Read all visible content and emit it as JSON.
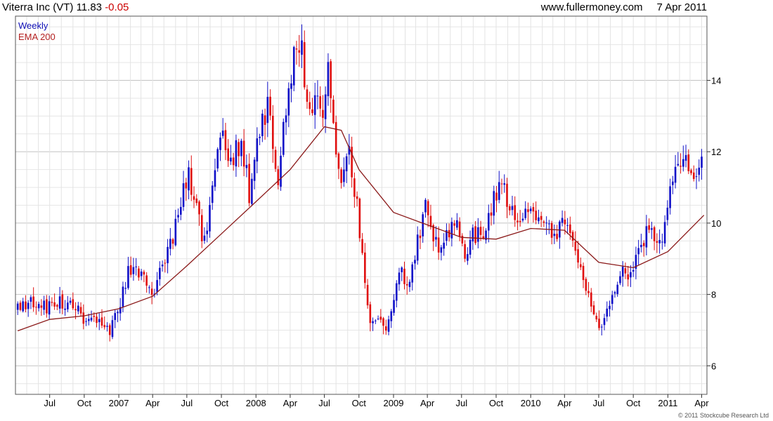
{
  "header": {
    "symbol": "Viterra Inc (VT) 11.83",
    "change": "-0.05",
    "site": "www.fullermoney.com",
    "date": "7 Apr 2011"
  },
  "legend": {
    "weekly": "Weekly",
    "ema": "EMA 200"
  },
  "copyright": "© 2011 Stockcube Research Ltd",
  "colors": {
    "up": "#1010c8",
    "down": "#e01010",
    "ema": "#8b1a1a",
    "grid": "#d8d8d8"
  },
  "chart_data": {
    "type": "candlestick",
    "frequency": "weekly",
    "x_range": [
      "2006-04",
      "2011-04"
    ],
    "ylim": [
      5.2,
      15.8
    ],
    "y_ticks": [
      6,
      8,
      10,
      12,
      14
    ],
    "y_axis_side": "right",
    "x_ticks": [
      {
        "label": "Jul",
        "date": "2006-07-01"
      },
      {
        "label": "Oct",
        "date": "2006-10-01"
      },
      {
        "label": "2007",
        "date": "2007-01-01"
      },
      {
        "label": "Apr",
        "date": "2007-04-01"
      },
      {
        "label": "Jul",
        "date": "2007-07-01"
      },
      {
        "label": "Oct",
        "date": "2007-10-01"
      },
      {
        "label": "2008",
        "date": "2008-01-01"
      },
      {
        "label": "Apr",
        "date": "2008-04-01"
      },
      {
        "label": "Jul",
        "date": "2008-07-01"
      },
      {
        "label": "Oct",
        "date": "2008-10-01"
      },
      {
        "label": "2009",
        "date": "2009-01-01"
      },
      {
        "label": "Apr",
        "date": "2009-04-01"
      },
      {
        "label": "Jul",
        "date": "2009-07-01"
      },
      {
        "label": "Oct",
        "date": "2009-10-01"
      },
      {
        "label": "2010",
        "date": "2010-01-01"
      },
      {
        "label": "Apr",
        "date": "2010-04-01"
      },
      {
        "label": "Jul",
        "date": "2010-07-01"
      },
      {
        "label": "Oct",
        "date": "2010-10-01"
      },
      {
        "label": "2011",
        "date": "2011-01-01"
      },
      {
        "label": "Apr",
        "date": "2011-04-01"
      }
    ],
    "grid": true,
    "close_path": [
      {
        "date": "2006-04-07",
        "value": 7.6
      },
      {
        "date": "2006-05-15",
        "value": 7.8
      },
      {
        "date": "2006-06-15",
        "value": 7.6
      },
      {
        "date": "2006-07-15",
        "value": 7.9
      },
      {
        "date": "2006-08-15",
        "value": 7.7
      },
      {
        "date": "2006-09-15",
        "value": 7.5
      },
      {
        "date": "2006-10-10",
        "value": 7.1
      },
      {
        "date": "2006-11-10",
        "value": 7.2
      },
      {
        "date": "2006-12-05",
        "value": 7.0
      },
      {
        "date": "2006-12-31",
        "value": 7.6
      },
      {
        "date": "2007-01-25",
        "value": 8.6
      },
      {
        "date": "2007-02-20",
        "value": 8.8
      },
      {
        "date": "2007-03-10",
        "value": 8.4
      },
      {
        "date": "2007-03-31",
        "value": 8.1
      },
      {
        "date": "2007-04-20",
        "value": 8.6
      },
      {
        "date": "2007-05-15",
        "value": 9.3
      },
      {
        "date": "2007-06-10",
        "value": 10.2
      },
      {
        "date": "2007-07-05",
        "value": 11.6
      },
      {
        "date": "2007-07-25",
        "value": 10.4
      },
      {
        "date": "2007-08-15",
        "value": 9.5
      },
      {
        "date": "2007-09-10",
        "value": 11.2
      },
      {
        "date": "2007-10-05",
        "value": 12.5
      },
      {
        "date": "2007-10-31",
        "value": 11.6
      },
      {
        "date": "2007-11-20",
        "value": 12.4
      },
      {
        "date": "2007-12-15",
        "value": 10.8
      },
      {
        "date": "2008-01-10",
        "value": 12.6
      },
      {
        "date": "2008-02-05",
        "value": 13.4
      },
      {
        "date": "2008-02-25",
        "value": 11.0
      },
      {
        "date": "2008-03-20",
        "value": 13.0
      },
      {
        "date": "2008-04-10",
        "value": 14.5
      },
      {
        "date": "2008-04-30",
        "value": 14.9
      },
      {
        "date": "2008-05-20",
        "value": 13.0
      },
      {
        "date": "2008-06-10",
        "value": 14.0
      },
      {
        "date": "2008-06-25",
        "value": 13.2
      },
      {
        "date": "2008-07-10",
        "value": 14.3
      },
      {
        "date": "2008-07-25",
        "value": 12.5
      },
      {
        "date": "2008-08-15",
        "value": 11.3
      },
      {
        "date": "2008-09-05",
        "value": 12.1
      },
      {
        "date": "2008-09-25",
        "value": 10.5
      },
      {
        "date": "2008-10-15",
        "value": 8.5
      },
      {
        "date": "2008-10-31",
        "value": 7.2
      },
      {
        "date": "2008-11-20",
        "value": 7.5
      },
      {
        "date": "2008-12-10",
        "value": 6.9
      },
      {
        "date": "2008-12-31",
        "value": 7.5
      },
      {
        "date": "2009-01-20",
        "value": 8.8
      },
      {
        "date": "2009-02-10",
        "value": 8.0
      },
      {
        "date": "2009-03-05",
        "value": 9.5
      },
      {
        "date": "2009-03-31",
        "value": 10.5
      },
      {
        "date": "2009-04-25",
        "value": 9.3
      },
      {
        "date": "2009-05-20",
        "value": 9.5
      },
      {
        "date": "2009-06-15",
        "value": 10.2
      },
      {
        "date": "2009-07-10",
        "value": 9.2
      },
      {
        "date": "2009-08-05",
        "value": 9.7
      },
      {
        "date": "2009-09-01",
        "value": 9.5
      },
      {
        "date": "2009-09-25",
        "value": 10.8
      },
      {
        "date": "2009-10-15",
        "value": 11.2
      },
      {
        "date": "2009-11-05",
        "value": 10.3
      },
      {
        "date": "2009-12-01",
        "value": 10.0
      },
      {
        "date": "2009-12-31",
        "value": 10.4
      },
      {
        "date": "2010-01-20",
        "value": 10.2
      },
      {
        "date": "2010-02-10",
        "value": 9.9
      },
      {
        "date": "2010-03-05",
        "value": 9.5
      },
      {
        "date": "2010-03-31",
        "value": 10.0
      },
      {
        "date": "2010-04-20",
        "value": 9.6
      },
      {
        "date": "2010-05-15",
        "value": 8.8
      },
      {
        "date": "2010-06-05",
        "value": 7.8
      },
      {
        "date": "2010-06-25",
        "value": 7.3
      },
      {
        "date": "2010-07-15",
        "value": 7.1
      },
      {
        "date": "2010-08-05",
        "value": 7.9
      },
      {
        "date": "2010-08-31",
        "value": 8.6
      },
      {
        "date": "2010-09-25",
        "value": 8.5
      },
      {
        "date": "2010-10-20",
        "value": 9.4
      },
      {
        "date": "2010-11-10",
        "value": 9.8
      },
      {
        "date": "2010-12-05",
        "value": 9.3
      },
      {
        "date": "2010-12-31",
        "value": 10.3
      },
      {
        "date": "2011-01-20",
        "value": 11.6
      },
      {
        "date": "2011-02-10",
        "value": 11.9
      },
      {
        "date": "2011-03-01",
        "value": 11.1
      },
      {
        "date": "2011-03-20",
        "value": 11.5
      },
      {
        "date": "2011-04-07",
        "value": 11.83
      }
    ],
    "ema_path": [
      {
        "date": "2006-04-07",
        "value": 6.98
      },
      {
        "date": "2006-07-01",
        "value": 7.3
      },
      {
        "date": "2006-10-01",
        "value": 7.4
      },
      {
        "date": "2007-01-01",
        "value": 7.6
      },
      {
        "date": "2007-04-01",
        "value": 7.95
      },
      {
        "date": "2007-07-01",
        "value": 8.8
      },
      {
        "date": "2007-10-01",
        "value": 9.7
      },
      {
        "date": "2008-01-01",
        "value": 10.6
      },
      {
        "date": "2008-04-01",
        "value": 11.5
      },
      {
        "date": "2008-07-01",
        "value": 12.7
      },
      {
        "date": "2008-08-15",
        "value": 12.6
      },
      {
        "date": "2008-10-01",
        "value": 11.5
      },
      {
        "date": "2009-01-01",
        "value": 10.3
      },
      {
        "date": "2009-04-01",
        "value": 9.95
      },
      {
        "date": "2009-07-01",
        "value": 9.6
      },
      {
        "date": "2009-10-01",
        "value": 9.55
      },
      {
        "date": "2010-01-01",
        "value": 9.85
      },
      {
        "date": "2010-04-01",
        "value": 9.8
      },
      {
        "date": "2010-07-01",
        "value": 8.9
      },
      {
        "date": "2010-10-01",
        "value": 8.75
      },
      {
        "date": "2011-01-01",
        "value": 9.2
      },
      {
        "date": "2011-04-07",
        "value": 10.22
      }
    ]
  }
}
